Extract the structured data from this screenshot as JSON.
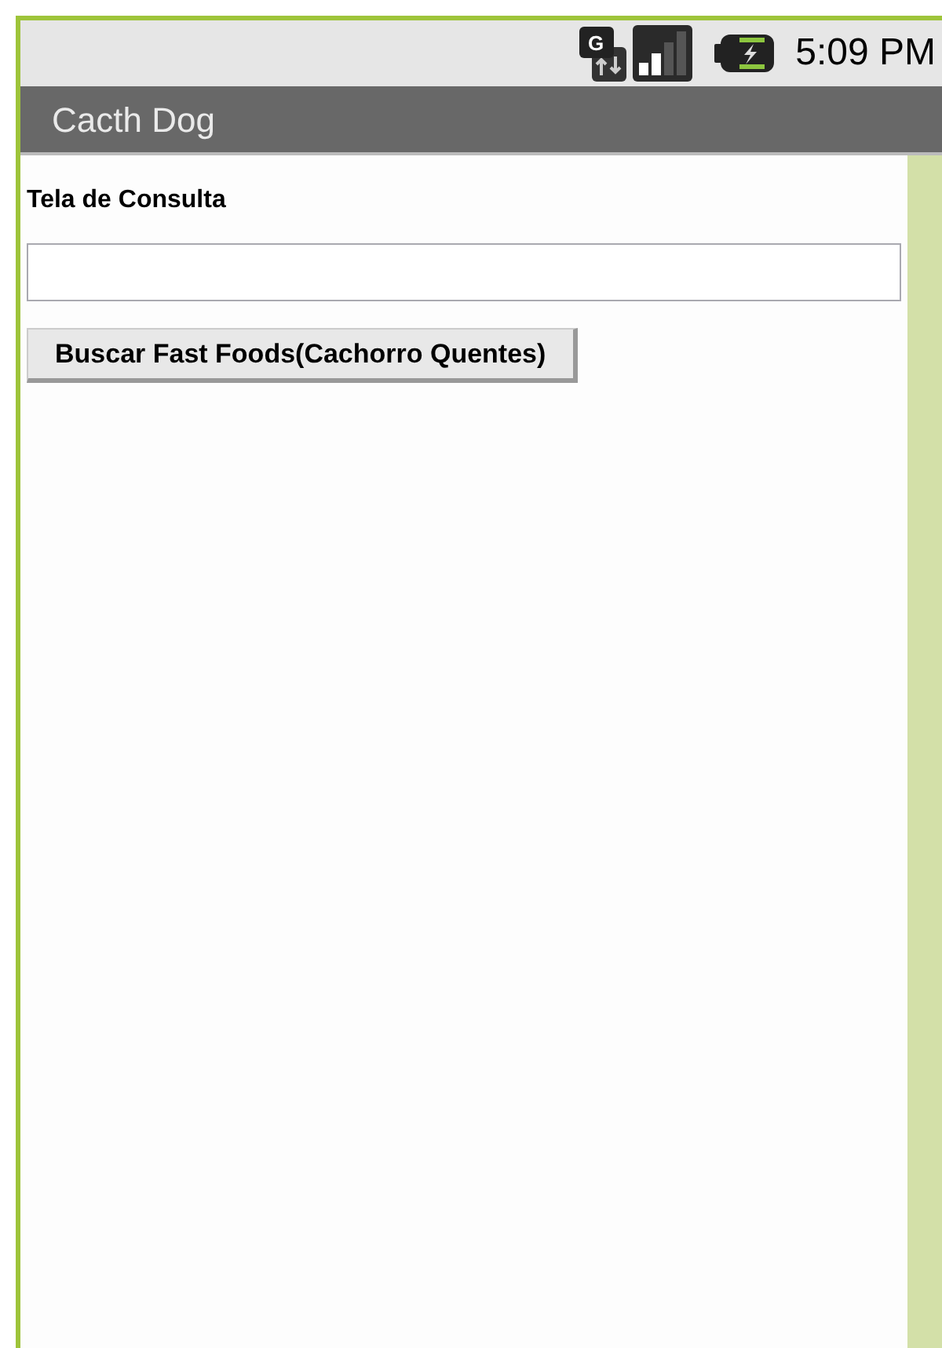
{
  "status_bar": {
    "time": "5:09 PM",
    "network_letter": "G"
  },
  "title_bar": {
    "title": "Cacth Dog"
  },
  "screen": {
    "label": "Tela de Consulta",
    "button": {
      "label": "Buscar Fast Foods(Cachorro Quentes)"
    }
  }
}
